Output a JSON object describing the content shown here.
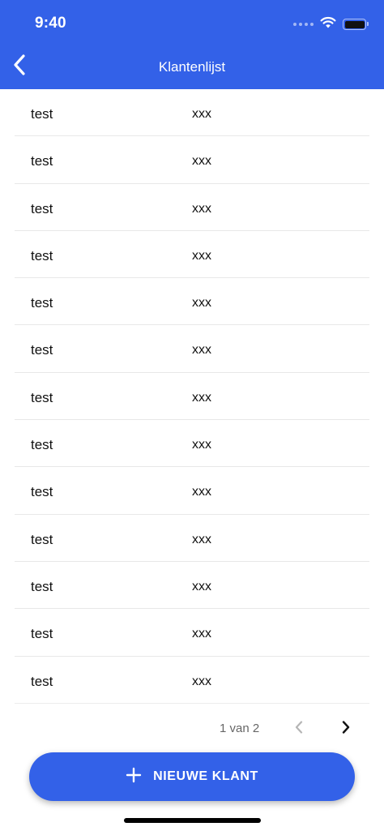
{
  "status_bar": {
    "time": "9:40"
  },
  "nav": {
    "title": "Klantenlijst",
    "back_icon": "chevron-left-icon"
  },
  "customers": [
    {
      "name": "test",
      "value": "xxx"
    },
    {
      "name": "test",
      "value": "xxx"
    },
    {
      "name": "test",
      "value": "xxx"
    },
    {
      "name": "test",
      "value": "xxx"
    },
    {
      "name": "test",
      "value": "xxx"
    },
    {
      "name": "test",
      "value": "xxx"
    },
    {
      "name": "test",
      "value": "xxx"
    },
    {
      "name": "test",
      "value": "xxx"
    },
    {
      "name": "test",
      "value": "xxx"
    },
    {
      "name": "test",
      "value": "xxx"
    },
    {
      "name": "test",
      "value": "xxx"
    },
    {
      "name": "test",
      "value": "xxx"
    },
    {
      "name": "test",
      "value": "xxx"
    }
  ],
  "pagination": {
    "label": "1 van 2",
    "current_page": 1,
    "total_pages": 2,
    "prev_icon": "chevron-left-icon",
    "next_icon": "chevron-right-icon"
  },
  "fab": {
    "label": "NIEUWE KLANT",
    "icon": "plus-icon"
  },
  "colors": {
    "primary": "#3361E8",
    "divider": "#e8e8e8",
    "text": "#111111",
    "muted": "#666666"
  }
}
